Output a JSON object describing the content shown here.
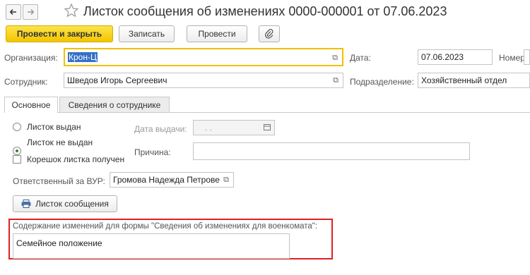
{
  "window": {
    "title": "Листок сообщения об изменениях 0000-000001 от 07.06.2023"
  },
  "toolbar": {
    "post_close_label": "Провести и закрыть",
    "save_label": "Записать",
    "post_label": "Провести"
  },
  "header": {
    "organization_label": "Организация:",
    "organization_value": "Крон-Ц",
    "date_label": "Дата:",
    "date_value": "07.06.2023",
    "number_label": "Номер:",
    "employee_label": "Сотрудник:",
    "employee_value": "Шведов Игорь Сергеевич",
    "department_label": "Подразделение:",
    "department_value": "Хозяйственный отдел"
  },
  "tabs": [
    {
      "label": "Основное"
    },
    {
      "label": "Сведения о сотруднике"
    }
  ],
  "main": {
    "radio_issued": "Листок выдан",
    "radio_not_issued": "Листок не выдан",
    "check_stub": "Корешок листка получен",
    "issue_date_label": "Дата выдачи:",
    "issue_date_value": ". .",
    "reason_label": "Причина:",
    "reason_value": "",
    "responsible_label": "Ответственный за ВУР:",
    "responsible_value": "Громова Надежда Петрове",
    "print_button_label": "Листок сообщения",
    "content_label": "Содержание изменений для формы \"Сведения об изменениях для военкомата\":",
    "content_value": "Семейное положение"
  },
  "colors": {
    "primary_button": "#f2c500",
    "focus_border": "#f0c000",
    "highlight_box": "#e02020",
    "radio_selected": "#2a8a3a"
  }
}
